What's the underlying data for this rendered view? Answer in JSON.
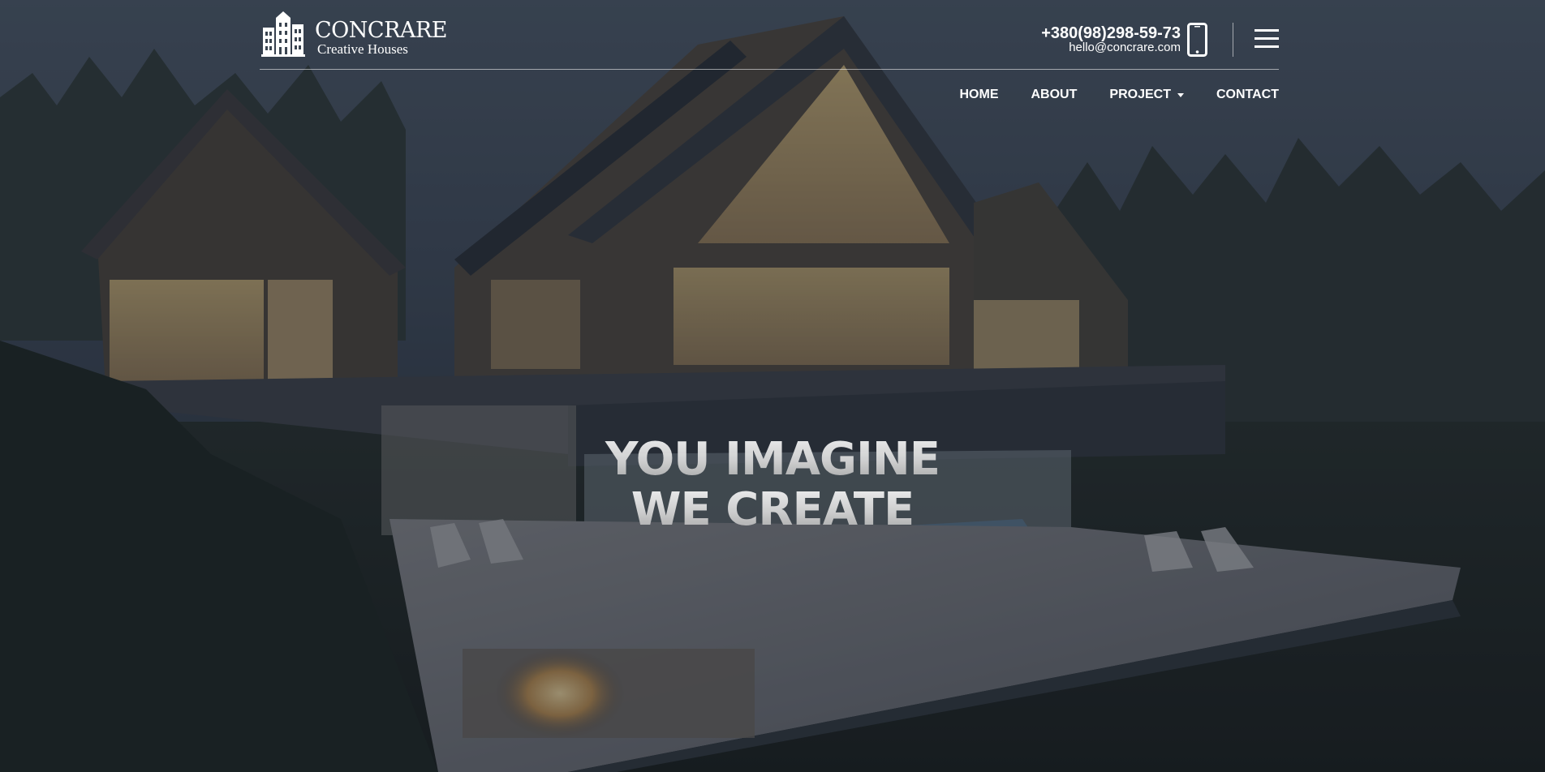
{
  "brand": {
    "name": "CONCRARE",
    "tagline": "Creative Houses"
  },
  "contact": {
    "phone": "+380(98)298-59-73",
    "email": "hello@concrare.com"
  },
  "nav": {
    "items": [
      {
        "label": "HOME"
      },
      {
        "label": "ABOUT"
      },
      {
        "label": "PROJECT"
      },
      {
        "label": "CONTACT"
      }
    ]
  },
  "hero": {
    "line1": "YOU IMAGINE",
    "line2": "WE CREATE"
  },
  "icons": {
    "logo": "building-icon",
    "phone": "mobile-phone-icon",
    "menu": "hamburger-menu-icon",
    "dropdown": "caret-down-icon"
  },
  "colors": {
    "text": "#ffffff",
    "overlay": "#1c2430"
  }
}
